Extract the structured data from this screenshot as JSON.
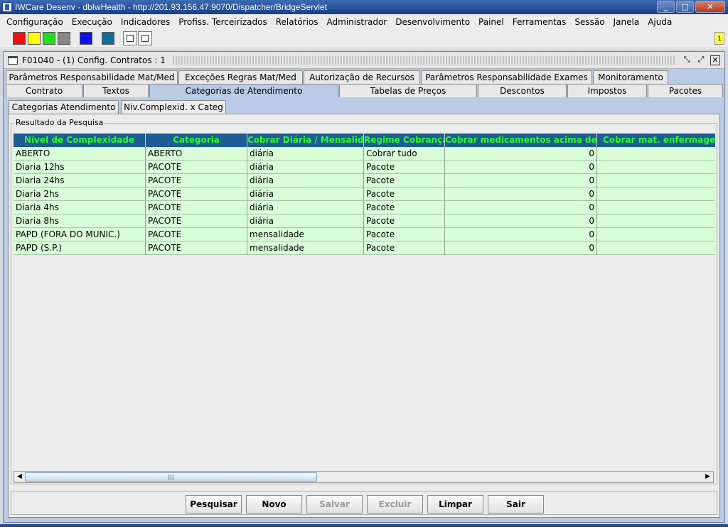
{
  "window": {
    "title": "IWCare Desenv - dbIwHealth - http://201.93.156.47:9070/Dispatcher/BridgeServlet",
    "controls": [
      "_",
      "□",
      "✕"
    ]
  },
  "menu": [
    "Configuração",
    "Execução",
    "Indicadores",
    "Profiss. Terceirizados",
    "Relatórios",
    "Administrador",
    "Desenvolvimento",
    "Painel",
    "Ferramentas",
    "Sessão",
    "Janela",
    "Ajuda"
  ],
  "toolbar": {
    "swatches": [
      "#ee1111",
      "#ffff00",
      "#22dd22",
      "#888888",
      "#1010ee",
      "#10709a"
    ],
    "notification_count": "1"
  },
  "internal_frame": {
    "title": "F01040 - (1) Config. Contratos : 1"
  },
  "tabs_top": [
    "Parâmetros Responsabilidade Mat/Med",
    "Exceções Regras Mat/Med",
    "Autorização de Recursos",
    "Parâmetros Responsabilidade Exames",
    "Monitoramento"
  ],
  "tabs_bottom": [
    "Contrato",
    "Textos",
    "Categorias de Atendimento",
    "Tabelas de Preços",
    "Descontos",
    "Impostos",
    "Pacotes"
  ],
  "subtabs": [
    "Categorias Atendimento",
    "Niv.Complexid. x Categ"
  ],
  "results": {
    "legend": "Resultado da Pesquisa",
    "columns": [
      "Nível de Complexidade",
      "Categoria",
      "Cobrar Diária / Mensalidade",
      "Regime Cobrança",
      "Cobrar medicamentos acima de",
      "Cobrar mat. enfermagem ac"
    ],
    "rows": [
      [
        "ABERTO",
        "ABERTO",
        "diária",
        "Cobrar tudo",
        "0",
        ""
      ],
      [
        "Diaria 12hs",
        "PACOTE",
        "diária",
        "Pacote",
        "0",
        ""
      ],
      [
        "Diaria 24hs",
        "PACOTE",
        "diária",
        "Pacote",
        "0",
        ""
      ],
      [
        "Diaria 2hs",
        "PACOTE",
        "diária",
        "Pacote",
        "0",
        ""
      ],
      [
        "Diaria 4hs",
        "PACOTE",
        "diária",
        "Pacote",
        "0",
        ""
      ],
      [
        "Diaria 8hs",
        "PACOTE",
        "diária",
        "Pacote",
        "0",
        ""
      ],
      [
        "PAPD (FORA DO MUNIC.)",
        "PACOTE",
        "mensalidade",
        "Pacote",
        "0",
        ""
      ],
      [
        "PAPD (S.P.)",
        "PACOTE",
        "mensalidade",
        "Pacote",
        "0",
        ""
      ]
    ]
  },
  "buttons": [
    {
      "label": "Pesquisar",
      "enabled": true
    },
    {
      "label": "Novo",
      "enabled": true
    },
    {
      "label": "Salvar",
      "enabled": false
    },
    {
      "label": "Excluir",
      "enabled": false
    },
    {
      "label": "Limpar",
      "enabled": true
    },
    {
      "label": "Sair",
      "enabled": true
    }
  ]
}
